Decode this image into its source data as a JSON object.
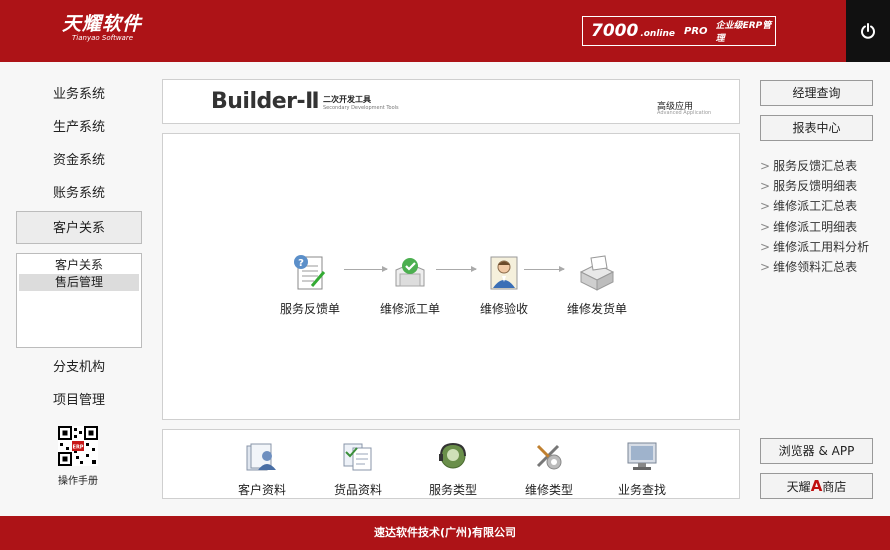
{
  "header": {
    "logo_main": "天耀软件",
    "logo_sub": "Tianyao Software",
    "badge_num": "7000",
    "badge_online": ".online",
    "badge_pro": "PRO",
    "badge_erp": "企业级ERP管理"
  },
  "left_nav": {
    "items": [
      "业务系统",
      "生产系统",
      "资金系统",
      "账务系统",
      "客户关系"
    ],
    "sub_items": [
      "客户关系",
      "售后管理"
    ],
    "items2": [
      "分支机构",
      "项目管理"
    ],
    "manual_label": "操作手册"
  },
  "banner": {
    "name": "Builder-Ⅱ",
    "cn": "二次开发工具",
    "en": "Secondary Development Tools",
    "adv": "高级应用",
    "adv_en": "Advanced Application"
  },
  "flow": {
    "steps": [
      "服务反馈单",
      "维修派工单",
      "维修验收",
      "维修发货单"
    ]
  },
  "tools": {
    "items": [
      "客户资料",
      "货品资料",
      "服务类型",
      "维修类型",
      "业务查找"
    ]
  },
  "right": {
    "btn_query": "经理查询",
    "btn_report": "报表中心",
    "links": [
      "服务反馈汇总表",
      "服务反馈明细表",
      "维修派工汇总表",
      "维修派工明细表",
      "维修派工用料分析",
      "维修领料汇总表"
    ],
    "btn_browser": "浏览器 & APP",
    "btn_shop_pre": "天耀",
    "btn_shop_a": "A",
    "btn_shop_post": "商店"
  },
  "footer": {
    "text": "速达软件技术(广州)有限公司"
  },
  "colors": {
    "brand_red": "#ad1317",
    "power_bg": "#111111"
  }
}
